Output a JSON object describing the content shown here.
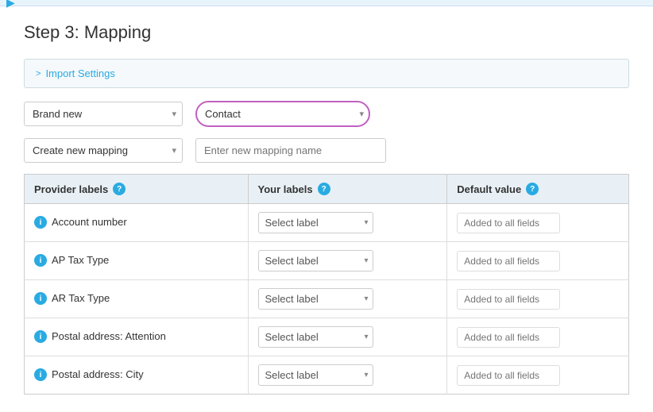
{
  "topbar": {
    "arrow": "▶"
  },
  "page": {
    "title": "Step 3: Mapping"
  },
  "import_settings": {
    "label": "Import Settings",
    "chevron": ">"
  },
  "controls": {
    "brand_new_value": "Brand new",
    "brand_new_options": [
      "Brand new"
    ],
    "contact_value": "Contact",
    "contact_options": [
      "Contact"
    ],
    "create_mapping_value": "Create new mapping",
    "create_mapping_options": [
      "Create new mapping"
    ],
    "mapping_name_placeholder": "Enter new mapping name"
  },
  "table": {
    "headers": {
      "provider_labels": "Provider labels",
      "your_labels": "Your labels",
      "default_value": "Default value"
    },
    "rows": [
      {
        "provider_label": "Account number",
        "your_label_placeholder": "Select label",
        "default_placeholder": "Added to all fields"
      },
      {
        "provider_label": "AP Tax Type",
        "your_label_placeholder": "Select label",
        "default_placeholder": "Added to all fields"
      },
      {
        "provider_label": "AR Tax Type",
        "your_label_placeholder": "Select label",
        "default_placeholder": "Added to all fields"
      },
      {
        "provider_label": "Postal address: Attention",
        "your_label_placeholder": "Select label",
        "default_placeholder": "Added to all fields"
      },
      {
        "provider_label": "Postal address: City",
        "your_label_placeholder": "Select label",
        "default_placeholder": "Added to all fields"
      }
    ]
  }
}
